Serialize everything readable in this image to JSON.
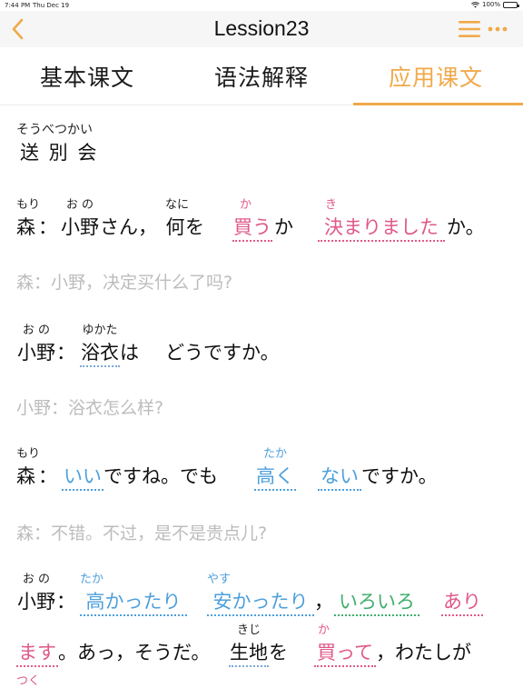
{
  "status_bar": {
    "time": "7:44 PM",
    "date": "Thu Dec 19",
    "battery": "100%"
  },
  "nav": {
    "title": "Lession23",
    "accent_color": "#f0a94a"
  },
  "tabs": [
    {
      "label": "基本课文",
      "active": false
    },
    {
      "label": "语法解释",
      "active": false
    },
    {
      "label": "应用课文",
      "active": true
    }
  ],
  "lesson": {
    "title_ruby": "そうべつかい",
    "title": "送 別 会",
    "lines": [
      {
        "speaker_ruby": "もり",
        "speaker": "森",
        "words": [
          {
            "ruby": "お の",
            "text": "小野"
          },
          {
            "ruby": "",
            "text": "さん，"
          },
          {
            "ruby": "なに",
            "text": "何"
          },
          {
            "ruby": "",
            "text": "を"
          },
          {
            "ruby": "か",
            "text": "買う"
          },
          {
            "ruby": "",
            "text": "か"
          },
          {
            "ruby": "き",
            "text": "決まりました"
          },
          {
            "ruby": "",
            "text": "か。"
          }
        ],
        "translation": "森：小野，决定买什么了吗?"
      },
      {
        "speaker_ruby": "お の",
        "speaker": "小野",
        "words": [
          {
            "ruby": "ゆかた",
            "text": "浴衣"
          },
          {
            "ruby": "",
            "text": "は"
          },
          {
            "ruby": "",
            "text": "どうですか。"
          }
        ],
        "translation": "小野：浴衣怎么样?"
      },
      {
        "speaker_ruby": "もり",
        "speaker": "森",
        "words": [
          {
            "ruby": "",
            "text": "いい"
          },
          {
            "ruby": "",
            "text": "ですね。でも"
          },
          {
            "ruby": "たか",
            "text": "高く"
          },
          {
            "ruby": "",
            "text": "ない"
          },
          {
            "ruby": "",
            "text": "ですか。"
          }
        ],
        "translation": "森：不错。不过，是不是贵点儿?"
      },
      {
        "speaker_ruby": "お の",
        "speaker": "小野",
        "words": [
          {
            "ruby": "たか",
            "text": "高かったり"
          },
          {
            "ruby": "やす",
            "text": "安かったり"
          },
          {
            "ruby": "",
            "text": "，"
          },
          {
            "ruby": "",
            "text": "いろいろ"
          },
          {
            "ruby": "",
            "text": "あり"
          }
        ],
        "words_line2": [
          {
            "ruby": "",
            "text": "ます"
          },
          {
            "ruby": "",
            "text": "。あっ，そうだ。"
          },
          {
            "ruby": "きじ",
            "text": "生地"
          },
          {
            "ruby": "",
            "text": "を"
          },
          {
            "ruby": "か",
            "text": "買って"
          },
          {
            "ruby": "",
            "text": "，わたしが"
          }
        ],
        "ruby_line3": "つく"
      }
    ]
  },
  "colors": {
    "pink": "#e0588a",
    "blue": "#4d9fdc",
    "green": "#3fae6c",
    "translation_gray": "#bcbcbc"
  }
}
